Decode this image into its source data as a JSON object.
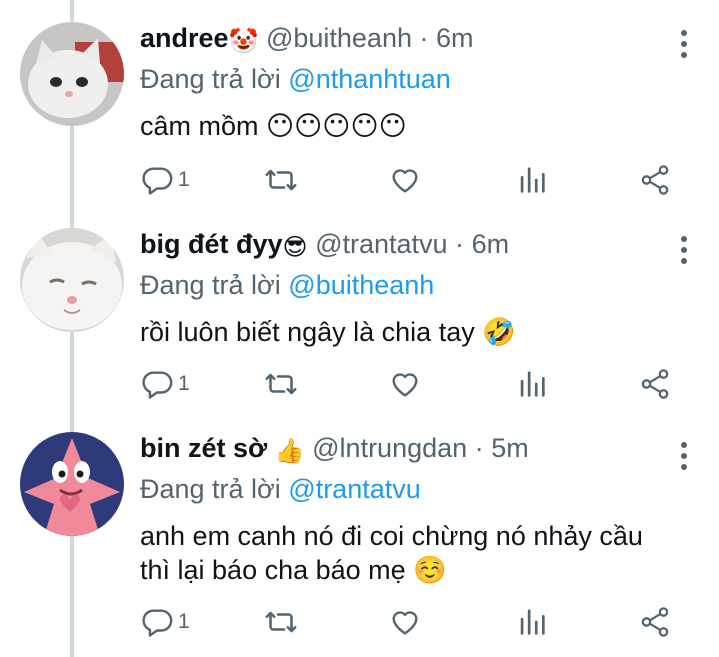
{
  "tweets": [
    {
      "name": "andree",
      "name_emoji": "🤡",
      "handle": "@buitheanh",
      "sep": "·",
      "time": "6m",
      "reply_prefix": "Đang trả lời",
      "reply_to": "@nthanhtuan",
      "text": "câm mồm 😶😶😶😶😶",
      "reply_count": "1",
      "avatar": "white-kitten-avatar"
    },
    {
      "name": "big đét đyy",
      "name_emoji": "😎",
      "handle": "@trantatvu",
      "sep": "·",
      "time": "6m",
      "reply_prefix": "Đang trả lời",
      "reply_to": "@buitheanh",
      "text": "rồi luôn biết ngây là chia tay 🤣",
      "reply_count": "1",
      "avatar": "white-cat-avatar"
    },
    {
      "name": "bin zét sờ",
      "name_emoji": "👍",
      "handle": "@lntrungdan",
      "sep": "·",
      "time": "5m",
      "reply_prefix": "Đang trả lời",
      "reply_to": "@trantatvu",
      "text": "anh em canh nó đi coi chừng nó nhảy cầu thì lại báo cha báo mẹ ☺️",
      "reply_count": "1",
      "avatar": "patrick-star-avatar"
    }
  ],
  "colors": {
    "text": "#0f1419",
    "secondary": "#536471",
    "link": "#1d9bf0",
    "thread_line": "#cfd9de"
  },
  "icons": [
    "reply-icon",
    "retweet-icon",
    "like-icon",
    "views-icon",
    "share-icon",
    "more-icon"
  ]
}
